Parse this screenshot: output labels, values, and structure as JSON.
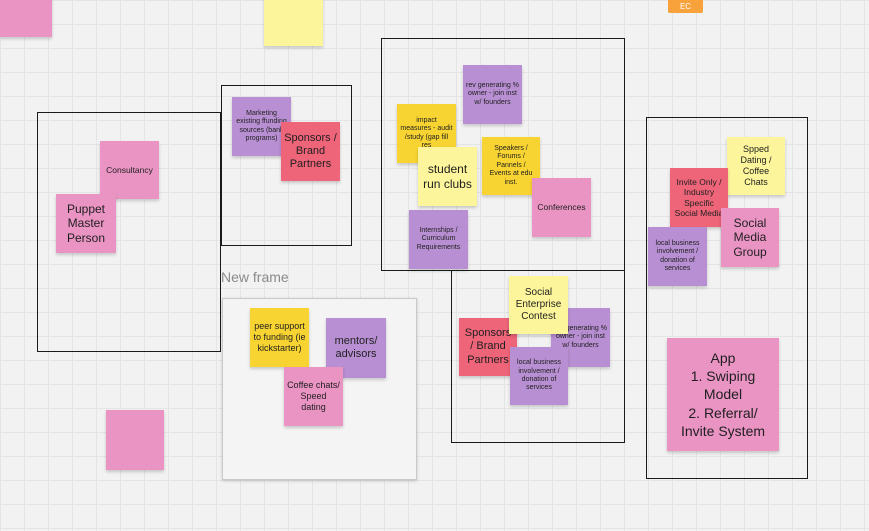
{
  "board": {
    "new_frame_label": "New frame",
    "user_badge": "EC"
  },
  "notes": {
    "topleft_pink": "",
    "top_yellow": "",
    "consultancy": "Consultancy",
    "puppet_master": "Puppet Master Person",
    "marketing_funding": "Marketing existing ffunding sources (bank programs)",
    "sponsors_a": "Sponsors / Brand Partners",
    "rev_generating_a": "rev generating % owner - join inst w/ founders",
    "impact_measures": "impact measures - audit /study (gap fill res",
    "student_clubs": "student run clubs",
    "speakers_forums": "Speakers / Forums / Pannels / Events at edu inst.",
    "conferences": "Conferences",
    "internships": "Internships / Curriculum Requirements",
    "spped_dating": "Spped Dating / Coffee Chats",
    "invite_only": "Invite Only / Industry Specific Social Media",
    "social_media_group": "Social Media Group",
    "local_business_a": "local business involvement / donation of services",
    "app_swiping": "App\n1. Swiping Model\n2. Referral/ Invite System",
    "peer_support": "peer support to funding (ie kickstarter)",
    "mentors": "mentors/ advisors",
    "coffee_chats": "Coffee chats/ Speed dating",
    "bottom_pink": "",
    "social_enterprise": "Social Enterprise Contest",
    "rev_generating_b": "rev generating % owner - join inst w/ founders",
    "sponsors_b": "Sponsors / Brand Partners",
    "local_business_b": "local business involvement / donation of services"
  }
}
